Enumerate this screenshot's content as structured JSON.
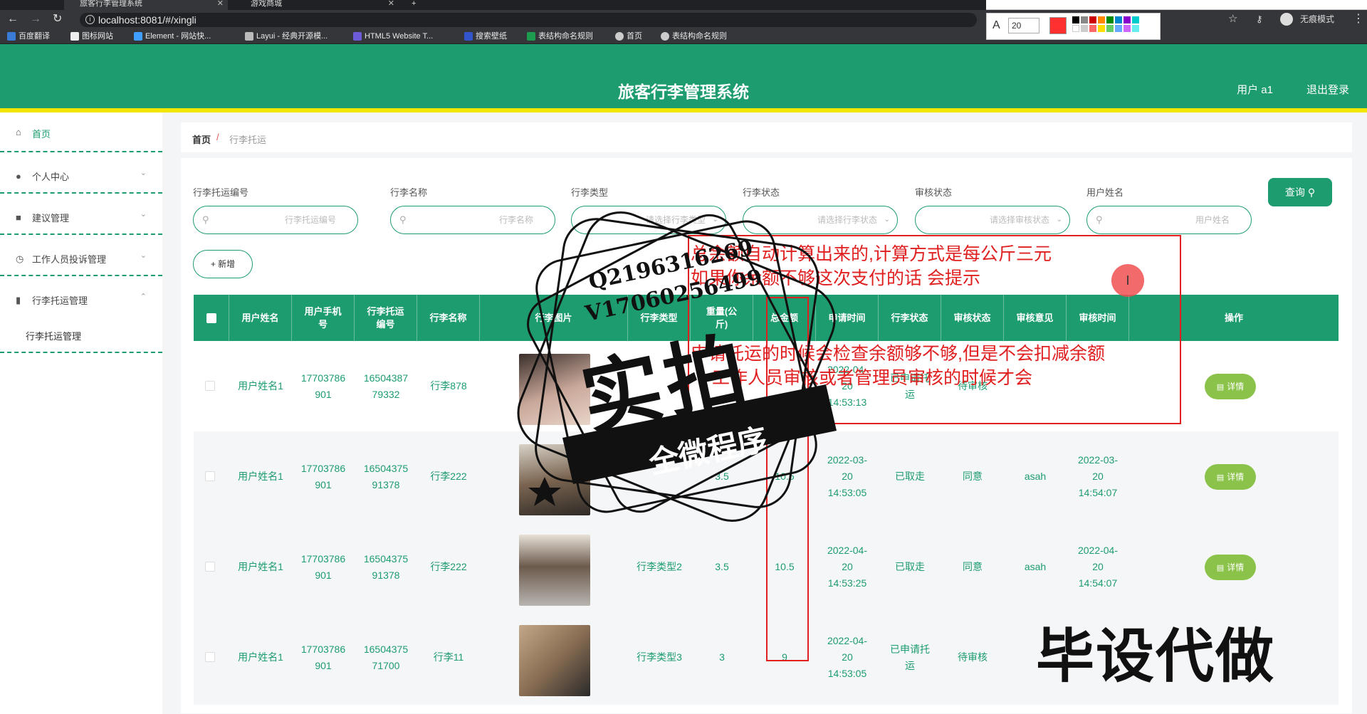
{
  "browser": {
    "tabs": [
      {
        "title": "旅客行李管理系统",
        "close": "✕"
      },
      {
        "title": "游戏商城",
        "close": "✕"
      }
    ],
    "new_tab": "+",
    "url": "localhost:8081/#/xingli",
    "mode": "无痕模式",
    "bookmarks": [
      {
        "label": "百度翻译",
        "color": "#3a7bd5"
      },
      {
        "label": "图标网站",
        "color": "#eeeeee"
      },
      {
        "label": "Element - 网站快...",
        "color": "#409eff"
      },
      {
        "label": "Layui - 经典开源模...",
        "color": "#bbbbbb"
      },
      {
        "label": "HTML5 Website T...",
        "color": "#6b5bd6"
      },
      {
        "label": "搜索壁纸",
        "color": "#3355cc"
      },
      {
        "label": "表结构命名规则",
        "color": "#1d9c4f"
      },
      {
        "label": "首页",
        "color": "#cccccc"
      },
      {
        "label": "表结构命名规则",
        "color": "#cccccc"
      }
    ],
    "draw_panel": {
      "font_size": "20"
    }
  },
  "header": {
    "title": "旅客行李管理系统",
    "user": "用户 a1",
    "logout": "退出登录",
    "accent": "#1d9c6f",
    "stripe": "#f2e600"
  },
  "sidebar": {
    "items": [
      {
        "label": "首页",
        "icon": "home-icon"
      },
      {
        "label": "个人中心",
        "icon": "user-icon"
      },
      {
        "label": "建议管理",
        "icon": "video-icon"
      },
      {
        "label": "工作人员投诉管理",
        "icon": "clock-icon"
      },
      {
        "label": "行李托运管理",
        "icon": "bar-chart-icon"
      }
    ],
    "submenu": "行李托运管理"
  },
  "breadcrumb": {
    "home": "首页",
    "sep": "/",
    "current": "行李托运"
  },
  "filters": [
    {
      "label": "行李托运编号",
      "placeholder": "行李托运编号",
      "kind": "input"
    },
    {
      "label": "行李名称",
      "placeholder": "行李名称",
      "kind": "input"
    },
    {
      "label": "行李类型",
      "placeholder": "请选择行李类型",
      "kind": "select"
    },
    {
      "label": "行李状态",
      "placeholder": "请选择行李状态",
      "kind": "select"
    },
    {
      "label": "审核状态",
      "placeholder": "请选择审核状态",
      "kind": "select"
    },
    {
      "label": "用户姓名",
      "placeholder": "用户姓名",
      "kind": "input"
    }
  ],
  "buttons": {
    "query": "查询",
    "add": "+ 新增",
    "detail": "详情"
  },
  "table": {
    "columns": [
      "用户姓名",
      "用户手机号",
      "行李托运编号",
      "行李名称",
      "行李图片",
      "行李类型",
      "重量(公斤)",
      "总金额",
      "申请时间",
      "行李状态",
      "审核状态",
      "审核意见",
      "审核时间",
      "操作"
    ],
    "rows": [
      {
        "name": "用户姓名1",
        "phone": "17703786901",
        "code": "1650438779332",
        "item": "行李878",
        "type": "",
        "weight": "",
        "amount": "",
        "apply_time": "2022-04-20 14:53:13",
        "status": "已申请托运",
        "audit": "待审核",
        "opinion": "",
        "audit_time": "",
        "photo": "#6d5a52"
      },
      {
        "name": "用户姓名1",
        "phone": "17703786901",
        "code": "1650437591378",
        "item": "行李222",
        "type": "",
        "weight": "3.5",
        "amount": "10.5",
        "apply_time": "2022-03-20 14:53:05",
        "status": "已取走",
        "audit": "同意",
        "opinion": "asah",
        "audit_time": "2022-03-20 14:54:07",
        "photo": "#7a6450"
      },
      {
        "name": "用户姓名1",
        "phone": "17703786901",
        "code": "1650437591378",
        "item": "行李222",
        "type": "行李类型2",
        "weight": "3.5",
        "amount": "10.5",
        "apply_time": "2022-04-20 14:53:25",
        "status": "已取走",
        "audit": "同意",
        "opinion": "asah",
        "audit_time": "2022-04-20 14:54:07",
        "photo": "#8a8580"
      },
      {
        "name": "用户姓名1",
        "phone": "17703786901",
        "code": "1650437571700",
        "item": "行李11",
        "type": "行李类型3",
        "weight": "3",
        "amount": "9",
        "apply_time": "2022-04-20 14:53:05",
        "status": "已申请托运",
        "audit": "待审核",
        "opinion": "",
        "audit_time": "",
        "photo": "#a08a70"
      }
    ]
  },
  "annotations": {
    "note1": "总余额自动计算出来的,计算方式是每公斤三元",
    "note2": "如果你余额不够这次支付的话 会提示",
    "note3": "申请托运的时候会检查余额够不够,但是不会扣减余额",
    "note4": "工作人员审核或者管理员审核的时候才会",
    "cursor": "I"
  },
  "stamp": {
    "qq": "Q2196316269",
    "vx": "V17060256499",
    "big": "实拍",
    "ribbon": "全微程序"
  },
  "watermark": "毕设代做"
}
